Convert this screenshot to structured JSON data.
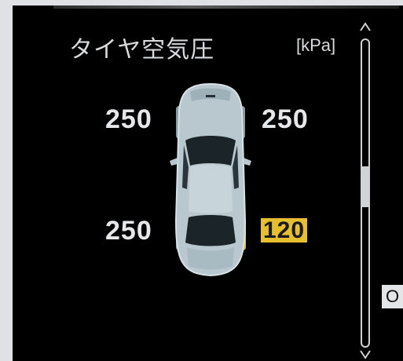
{
  "screen": {
    "title": "タイヤ空気圧",
    "unit": "[kPa]"
  },
  "tires": {
    "front_left": "250",
    "front_right": "250",
    "rear_left": "250",
    "rear_right": "120",
    "rear_right_status": "warning"
  },
  "side_tab": {
    "label": "O"
  },
  "colors": {
    "background": "#000000",
    "text": "#e6e7e8",
    "warning": "#e5bf2f",
    "car_body": "#b9c9cf"
  },
  "icons": {
    "scroll_up": "chevron-up-icon",
    "scroll_down": "chevron-down-icon",
    "car": "car-top-view-icon"
  }
}
